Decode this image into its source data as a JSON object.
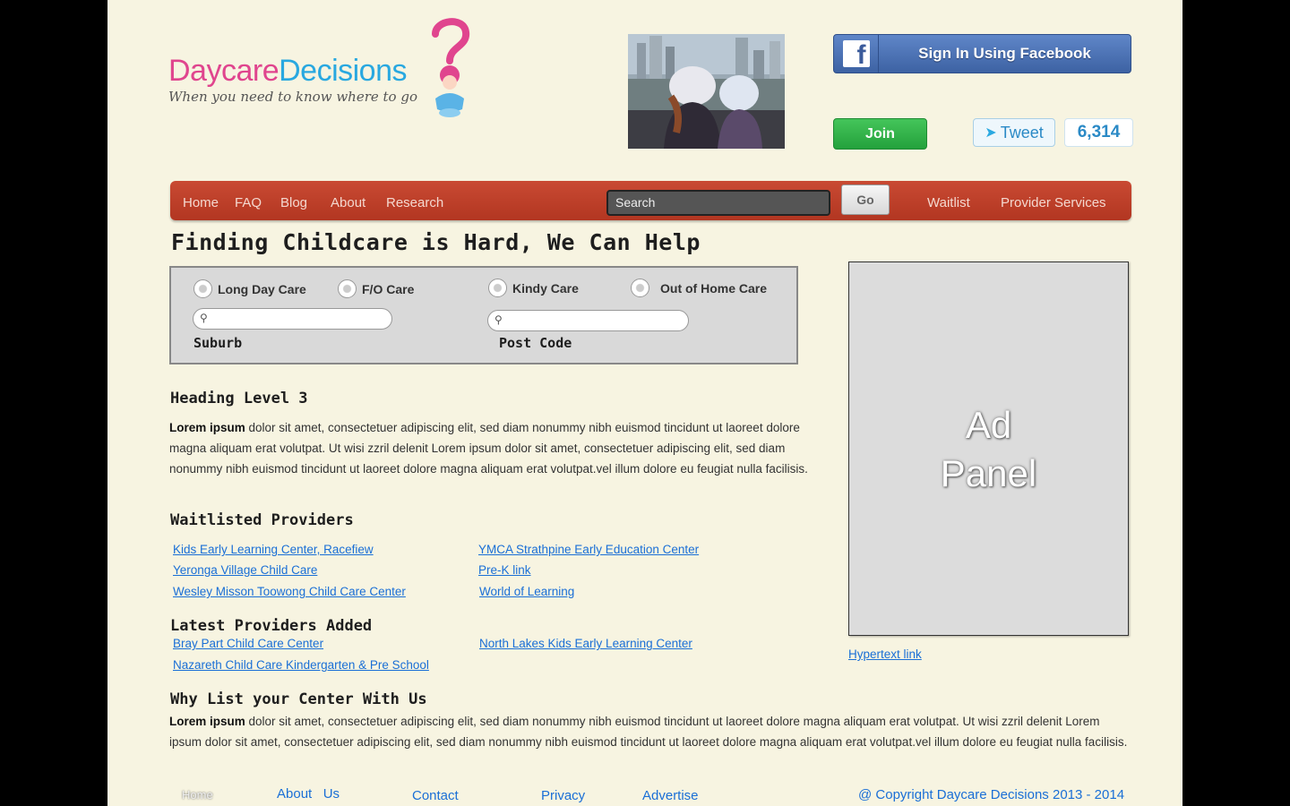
{
  "brand": {
    "name_part1": "Daycare",
    "name_part2": "Decisions",
    "tagline": "When you need to know where to go",
    "colors": {
      "pink": "#e0458e",
      "blue": "#29a8e0",
      "nav_red": "#c94a33",
      "link_blue": "#1a6fd6",
      "page_bg": "#f7f4e1"
    }
  },
  "header": {
    "facebook_label": "Sign In Using Facebook",
    "facebook_icon": "facebook-icon",
    "join_label": "Join",
    "tweet_label": "Tweet",
    "tweet_icon": "twitter-bird-icon",
    "tweet_count": "6,314"
  },
  "nav": {
    "items": [
      "Home",
      "FAQ",
      "Blog",
      "About",
      "Research"
    ],
    "search_placeholder": "Search",
    "go_label": "Go",
    "right_items": [
      "Waitlist",
      "Provider Services"
    ]
  },
  "main": {
    "title": "Finding Childcare is Hard, We Can Help",
    "care_types": [
      "Long Day Care",
      "F/O Care",
      "Kindy Care",
      "Out of Home Care"
    ],
    "suburb_label": "Suburb",
    "postcode_label": "Post Code",
    "section1": {
      "heading": "Heading Level 3",
      "lead": "Lorem ipsum",
      "text": " dolor sit amet, consectetuer adipiscing elit, sed diam nonummy nibh euismod tincidunt ut laoreet dolore magna aliquam erat volutpat. Ut wisi zzril delenit Lorem ipsum dolor sit amet, consectetuer adipiscing elit, sed diam nonummy nibh euismod tincidunt ut laoreet dolore magna aliquam erat volutpat.vel illum dolore eu feugiat nulla facilisis."
    },
    "waitlisted": {
      "heading": "Waitlisted Providers",
      "left": [
        "Kids Early Learning Center, Racefiew",
        "Yeronga Village Child Care",
        "Wesley Misson Toowong Child Care Center"
      ],
      "right": [
        "YMCA Strathpine Early Education Center",
        "Pre-K link",
        "World of Learning"
      ]
    },
    "latest": {
      "heading": "Latest Providers Added",
      "left": [
        "Bray Part Child Care Center",
        "Nazareth Child Care Kindergarten & Pre  School"
      ],
      "right": [
        "North Lakes Kids Early Learning Center"
      ]
    },
    "why": {
      "heading": "Why List your Center With Us",
      "lead": "Lorem ipsum",
      "text": " dolor sit amet, consectetuer adipiscing elit, sed diam nonummy nibh euismod tincidunt ut laoreet dolore magna aliquam erat volutpat. Ut wisi zzril delenit Lorem ipsum dolor sit amet, consectetuer adipiscing elit, sed diam nonummy nibh euismod tincidunt ut laoreet dolore magna aliquam erat volutpat.vel illum dolore eu feugiat nulla facilisis."
    }
  },
  "sidebar": {
    "ad_line1": "Ad",
    "ad_line2": "Panel",
    "link": "Hypertext link"
  },
  "footer": {
    "home": "Home",
    "about": "About   Us",
    "contact": "Contact",
    "privacy": "Privacy",
    "advertise": "Advertise",
    "copyright": "@ Copyright Daycare Decisions 2013 - 2014"
  }
}
